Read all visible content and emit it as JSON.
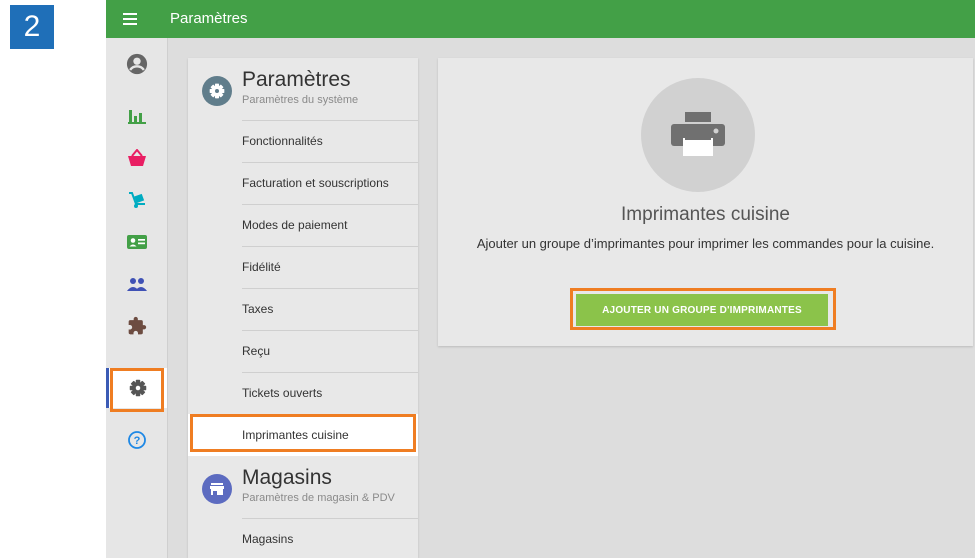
{
  "step_badge": "2",
  "topbar": {
    "title": "Paramètres",
    "menu_icon": "hamburger-icon",
    "color": "#43a047"
  },
  "rail": {
    "items": [
      {
        "name": "profile",
        "icon": "account-circle-icon",
        "color": "#666666"
      },
      {
        "name": "reports",
        "icon": "bar-chart-icon",
        "color": "#43a047"
      },
      {
        "name": "items",
        "icon": "basket-icon",
        "color": "#e91e63"
      },
      {
        "name": "inventory",
        "icon": "hand-truck-icon",
        "color": "#00acc1"
      },
      {
        "name": "employees",
        "icon": "id-card-icon",
        "color": "#43a047"
      },
      {
        "name": "customers",
        "icon": "people-icon",
        "color": "#3f51b5"
      },
      {
        "name": "integrations",
        "icon": "puzzle-icon",
        "color": "#6d4c41"
      },
      {
        "name": "settings",
        "icon": "gear-icon",
        "color": "#555555",
        "active": true
      },
      {
        "name": "help",
        "icon": "help-circle-icon",
        "color": "#1e88e5"
      }
    ]
  },
  "settings_section": {
    "title": "Paramètres",
    "subtitle": "Paramètres du système",
    "icon": "gear-icon",
    "items": [
      "Fonctionnalités",
      "Facturation et souscriptions",
      "Modes de paiement",
      "Fidélité",
      "Taxes",
      "Reçu",
      "Tickets ouverts",
      "Imprimantes cuisine"
    ],
    "selected_index": 7
  },
  "stores_section": {
    "title": "Magasins",
    "subtitle": "Paramètres de magasin & PDV",
    "icon": "store-icon",
    "items": [
      "Magasins"
    ]
  },
  "card": {
    "icon": "printer-icon",
    "title": "Imprimantes cuisine",
    "description": "Ajouter un groupe d’imprimantes pour imprimer les commandes pour la cuisine.",
    "button_label": "AJOUTER UN GROUPE D'IMPRIMANTES",
    "button_color": "#8bc34a"
  },
  "highlight_color": "#ef7d22"
}
